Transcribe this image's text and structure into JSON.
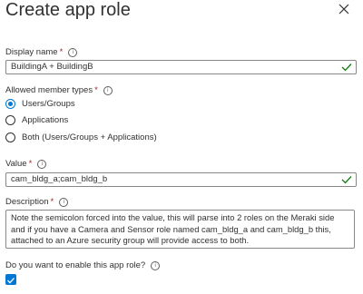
{
  "panel": {
    "title": "Create app role"
  },
  "display_name": {
    "label": "Display name",
    "required_mark": "*",
    "value": "BuildingA + BuildingB"
  },
  "allowed_member_types": {
    "label": "Allowed member types",
    "required_mark": "*",
    "options": [
      {
        "label": "Users/Groups",
        "selected": true
      },
      {
        "label": "Applications",
        "selected": false
      },
      {
        "label": "Both (Users/Groups + Applications)",
        "selected": false
      }
    ]
  },
  "value_field": {
    "label": "Value",
    "required_mark": "*",
    "value": "cam_bldg_a;cam_bldg_b"
  },
  "description": {
    "label": "Description",
    "required_mark": "*",
    "value": "Note the semicolon forced into the value, this will parse into 2 roles on the Meraki side and if you have a Camera and Sensor role named cam_bldg_a and cam_bldg_b this, attached to an Azure security group will provide access to both."
  },
  "enable": {
    "label": "Do you want to enable this app role?",
    "checked": true
  },
  "colors": {
    "accent": "#0078d4",
    "valid": "#107c10",
    "required": "#a4262c"
  }
}
